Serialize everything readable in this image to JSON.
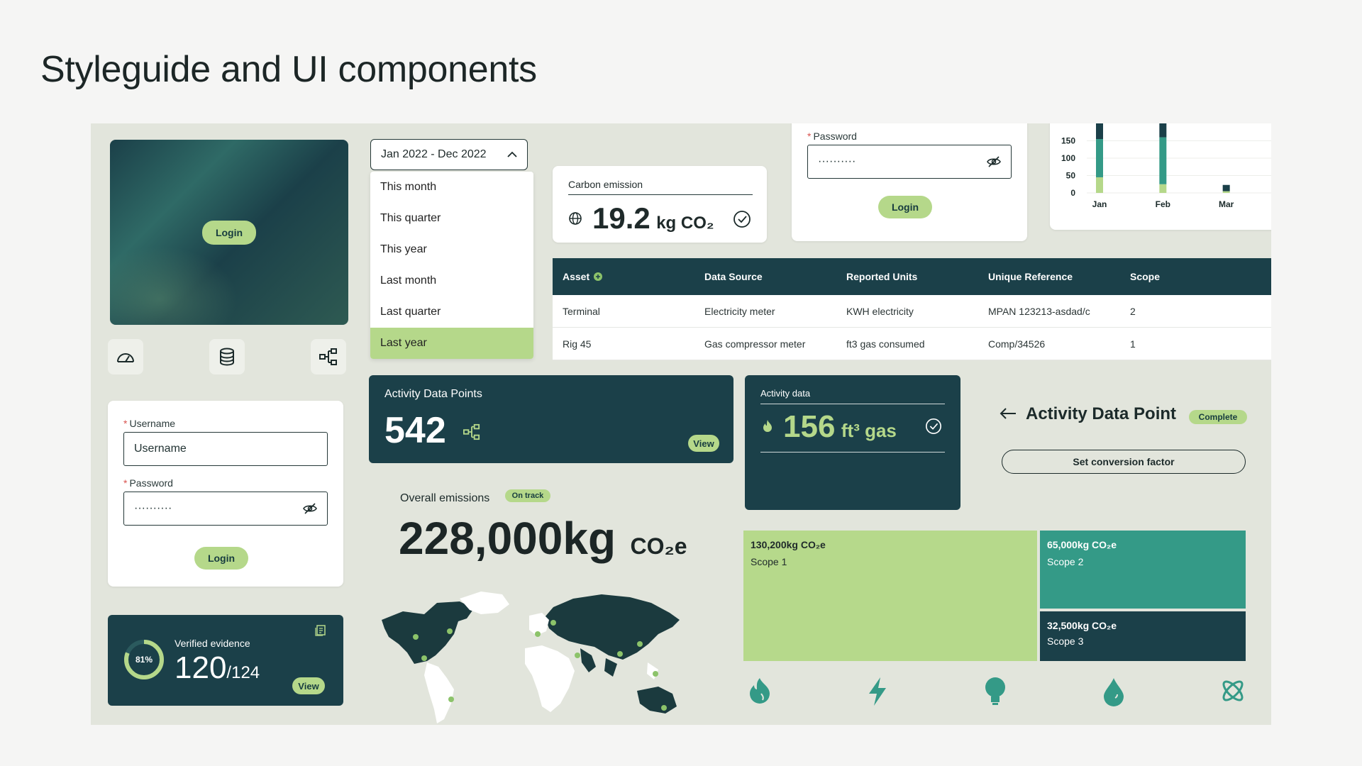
{
  "page": {
    "title": "Styleguide and UI components"
  },
  "login_hero": {
    "button": "Login"
  },
  "icons_row": [
    "gauge-icon",
    "database-icon",
    "hierarchy-icon"
  ],
  "login_form": {
    "username_label": "Username",
    "username_placeholder": "Username",
    "password_label": "Password",
    "password_value": "··········",
    "login_button": "Login"
  },
  "verified": {
    "title": "Verified evidence",
    "percent": "81%",
    "percent_value": 0.81,
    "value": "120",
    "total": "/124",
    "button": "View"
  },
  "date_dropdown": {
    "selected": "Jan 2022 - Dec 2022",
    "options": [
      "This month",
      "This quarter",
      "This year",
      "Last month",
      "Last quarter",
      "Last year"
    ],
    "highlighted": "Last year"
  },
  "carbon": {
    "label": "Carbon emission",
    "value": "19.2",
    "unit": "kg CO₂"
  },
  "password_card": {
    "label": "Password",
    "value": "··········",
    "button": "Login"
  },
  "mini_chart": {
    "type": "bar",
    "ticks": [
      "150",
      "100",
      "50",
      "0"
    ],
    "categories": [
      "Jan",
      "Feb",
      "Mar"
    ]
  },
  "chart_data": {
    "type": "bar",
    "categories": [
      "Jan",
      "Feb",
      "Mar"
    ],
    "series": [
      {
        "values": [
          45,
          25,
          5
        ]
      },
      {
        "values": [
          110,
          135,
          0
        ]
      },
      {
        "values": [
          200,
          200,
          18
        ]
      }
    ],
    "ylim": [
      0,
      200
    ],
    "yticks": [
      0,
      50,
      100,
      150
    ]
  },
  "table": {
    "headers": [
      "Asset",
      "Data Source",
      "Reported Units",
      "Unique Reference",
      "Scope"
    ],
    "rows": [
      [
        "Terminal",
        "Electricity meter",
        "KWH electricity",
        "MPAN 123213-asdad/c",
        "2"
      ],
      [
        "Rig 45",
        "Gas compressor meter",
        "ft3 gas consumed",
        "Comp/34526",
        "1"
      ]
    ]
  },
  "activity_points": {
    "title": "Activity Data Points",
    "value": "542",
    "button": "View"
  },
  "activity_data": {
    "label": "Activity data",
    "value": "156",
    "unit": "ft³ gas"
  },
  "adp_header": {
    "title": "Activity Data Point",
    "badge": "Complete",
    "button": "Set conversion factor"
  },
  "overall": {
    "label": "Overall emissions",
    "badge": "On track",
    "value": "228,000kg",
    "unit": "CO₂e"
  },
  "treemap": [
    {
      "value": "130,200kg CO₂e",
      "scope": "Scope 1",
      "color": "#b6d98b"
    },
    {
      "value": "65,000kg CO₂e",
      "scope": "Scope 2",
      "color": "#349a87"
    },
    {
      "value": "32,500kg CO₂e",
      "scope": "Scope 3",
      "color": "#1b4049"
    }
  ],
  "bottom_icons": [
    "flame-icon",
    "lightning-icon",
    "lightbulb-icon",
    "water-drop-icon",
    "atom-icon"
  ],
  "colors": {
    "dark": "#1b4049",
    "teal": "#349a87",
    "green": "#b5d88a",
    "board": "#e2e5dc"
  }
}
